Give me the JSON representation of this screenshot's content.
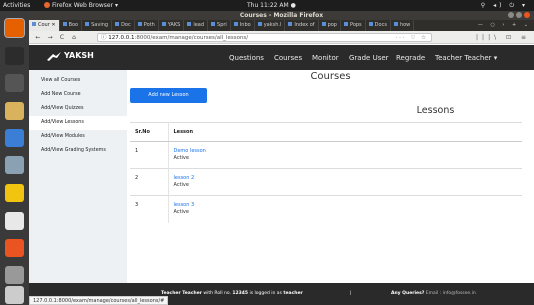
{
  "desktop": {
    "activities": "Activities",
    "app_menu": "Firefox Web Browser ▾",
    "clock": "Thu 11:22 AM ●",
    "system_icons": "⚲ ◂) ⏻ ▾",
    "accent": "#e95420"
  },
  "dock": [
    {
      "name": "firefox-icon",
      "color": "#e66000"
    },
    {
      "name": "terminal-icon",
      "color": "#2c2c2c"
    },
    {
      "name": "files-video-icon",
      "color": "#555555"
    },
    {
      "name": "text-editor-icon",
      "color": "#d8b25c"
    },
    {
      "name": "chromium-icon",
      "color": "#3b7ed6"
    },
    {
      "name": "screenshot-app-icon",
      "color": "#8aa1b3"
    },
    {
      "name": "rhythmbox-icon",
      "color": "#f1c40f"
    },
    {
      "name": "document-viewer-icon",
      "color": "#e8e8e8"
    },
    {
      "name": "software-center-icon",
      "color": "#e95420"
    },
    {
      "name": "network-icon",
      "color": "#999999"
    },
    {
      "name": "show-apps-icon",
      "color": "#cccccc"
    }
  ],
  "browser": {
    "window_title": "Courses - Mozilla Firefox",
    "tabs": [
      {
        "label": "Cour ✕"
      },
      {
        "label": "Boo"
      },
      {
        "label": "Saving"
      },
      {
        "label": "Doc"
      },
      {
        "label": "Poth"
      },
      {
        "label": "YAKS"
      },
      {
        "label": "lead"
      },
      {
        "label": "Spri"
      },
      {
        "label": "Inbo"
      },
      {
        "label": "yaksh.l"
      },
      {
        "label": "Index of"
      },
      {
        "label": "pop"
      },
      {
        "label": "Pops"
      },
      {
        "label": "Docs"
      },
      {
        "label": "how"
      }
    ],
    "tab_extra": "— ○ › + ⌄",
    "nav_buttons": {
      "back": "←",
      "forward": "→",
      "reload": "C",
      "home": "⌂"
    },
    "url_info_icon": "ⓘ",
    "url_host": "127.0.0.1",
    "url_path": ":8000/exam/manage/courses/all_lessons/",
    "url_right_icons": "··· ♡ ☆",
    "toolbar_right": "|||\\ ⊡ ≡",
    "status_url": "127.0.0.1:8000/exam/manage/courses/all_lessons/#"
  },
  "site": {
    "brand": "YAKSH",
    "nav": [
      "Questions",
      "Courses",
      "Monitor",
      "Grade User",
      "Regrade",
      "Teacher Teacher ▾"
    ],
    "sidebar": [
      "View all Courses",
      "Add New Course",
      "Add/View Quizzes",
      "Add/View Lessons",
      "Add/View Modules",
      "Add/View Grading Systems"
    ],
    "active_sidebar_index": 3,
    "page_title": "Courses",
    "add_button": "Add new Lesson",
    "lessons_title": "Lessons",
    "table": {
      "headers": [
        "Sr.No",
        "Lesson"
      ],
      "rows": [
        {
          "sr": "1",
          "lesson": "Demo lesson",
          "status": "Active"
        },
        {
          "sr": "2",
          "lesson": "lesson 2",
          "status": "Active"
        },
        {
          "sr": "3",
          "lesson": "lesson 3",
          "status": "Active"
        }
      ]
    },
    "footer": {
      "left_prefix": "Teacher Teacher",
      "left_mid1": " with Roll no. ",
      "roll": "12345",
      "left_mid2": " is logged in as ",
      "role": "teacher",
      "pipe": "|",
      "right_label": "Any Queries?",
      "right_email": " Email : info@fossee.in"
    },
    "link_color": "#1a73e8",
    "nav_bg": "#2a2a2a"
  }
}
